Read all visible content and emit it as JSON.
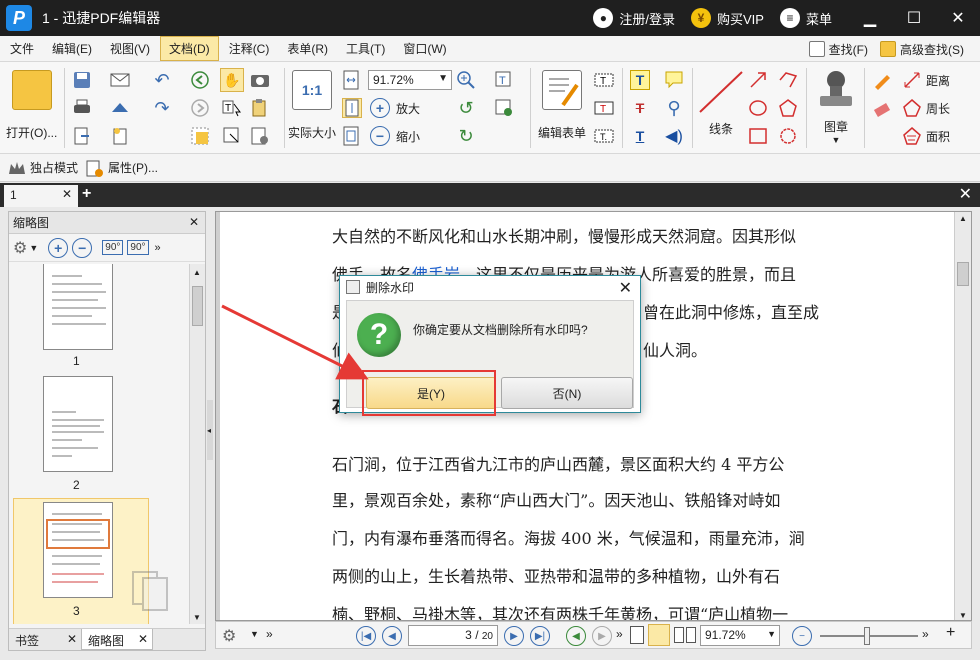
{
  "titlebar": {
    "logo_letter": "P",
    "title": "1 - 迅捷PDF编辑器",
    "login": "注册/登录",
    "vip": "购买VIP",
    "menu": "菜单",
    "user_icon": "user-icon",
    "vip_icon": "yen-icon",
    "menu_icon": "hamburger-icon"
  },
  "menubar": {
    "items": [
      "文件",
      "编辑(E)",
      "视图(V)",
      "文档(D)",
      "注释(C)",
      "表单(R)",
      "工具(T)",
      "窗口(W)"
    ],
    "active_index": 3,
    "find": "查找(F)",
    "advanced_find": "高级查找(S)"
  },
  "ribbon": {
    "open": "打开(O)...",
    "actual_size": "实际大小",
    "zoom_value": "91.72%",
    "zoom_in": "放大",
    "zoom_out": "缩小",
    "edit_form": "编辑表单",
    "lines": "线条",
    "stamp": "图章",
    "distance": "距离",
    "perimeter": "周长",
    "area": "面积",
    "actual_size_icon_text": "1:1"
  },
  "modebar": {
    "exclusive_mode": "独占模式",
    "properties": "属性(P)..."
  },
  "tabs": {
    "doc_tab": "1"
  },
  "left_panel": {
    "title": "缩略图",
    "thumbs": [
      "1",
      "2",
      "3"
    ],
    "rotate_left": "90°",
    "rotate_right": "90°",
    "tab_bookmarks": "书签",
    "tab_thumbnails": "缩略图"
  },
  "document": {
    "lines": [
      "大自然的不断风化和山水长期冲刷，慢慢形成天然洞窟。因其形似",
      "佛手，故名",
      "佛手岩",
      "。这里不仅是历来是为游人所喜爱的胜景，而且",
      "是",
      "曾在此洞中修炼，直至成",
      "仙",
      "仙人洞。",
      "石",
      "石门涧，位于江西省九江市的庐山西麓，景区面积大约 4 平方公",
      "里，景观百余处，素称“庐山西大门”。因天池山、铁船锋对峙如",
      "门，内有瀑布垂落而得名。海拔 400 米，气候温和，雨量充沛，涧",
      "两侧的山上，生长着热带、亚热带和温带的多种植物，山外有石",
      "楠、野桐、马褂木等，其次还有两株千年黄杨，可谓“庐山植物一"
    ]
  },
  "statusbar": {
    "page_current": "3",
    "page_total": "20",
    "zoom": "91.72%"
  },
  "dialog": {
    "title": "删除水印",
    "message": "你确定要从文档删除所有水印吗?",
    "yes": "是(Y)",
    "no": "否(N)"
  },
  "colors": {
    "titlebar_bg": "#1f1f1f",
    "accent_blue": "#1e88e5",
    "highlight_red": "#e53935",
    "yes_button": "#f8d98a",
    "question_green": "#4caf50"
  }
}
